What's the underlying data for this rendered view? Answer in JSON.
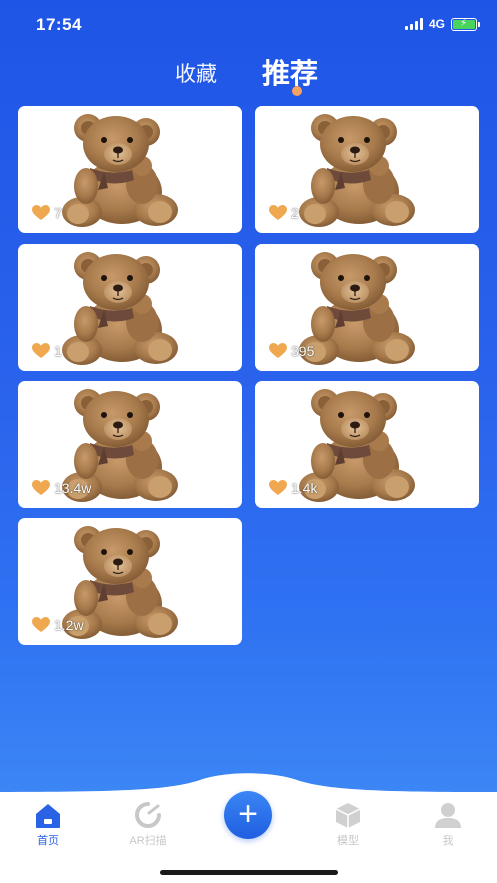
{
  "status_bar": {
    "time": "17:54",
    "network": "4G"
  },
  "top_tabs": [
    {
      "label": "收藏",
      "active": false
    },
    {
      "label": "推荐",
      "active": true
    }
  ],
  "colors": {
    "accent": "#2a62e6",
    "indicator": "#f5a35e",
    "heart": "#f0a850"
  },
  "cards": [
    {
      "likes": "7"
    },
    {
      "likes": "2"
    },
    {
      "likes": "1"
    },
    {
      "likes": "395"
    },
    {
      "likes": "13.4w"
    },
    {
      "likes": "1.4k"
    },
    {
      "likes": "1.2w"
    }
  ],
  "tabbar": {
    "home": "首页",
    "ar_scan": "AR扫描",
    "model": "模型",
    "me": "我"
  },
  "icons": [
    "home-icon",
    "ar-scan-icon",
    "plus-icon",
    "model-cube-icon",
    "user-icon",
    "heart-icon",
    "teddy-bear-image"
  ]
}
